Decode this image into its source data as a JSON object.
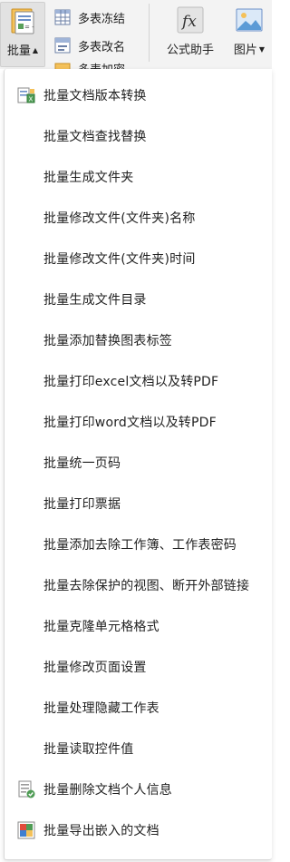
{
  "ribbon": {
    "batch_button": {
      "label": "批量",
      "icon": "batch-tools-icon"
    },
    "multi_sheet_freeze": {
      "label": "多表冻结",
      "icon": "table-grid-icon"
    },
    "multi_sheet_rename": {
      "label": "多表改名",
      "icon": "table-rename-icon"
    },
    "multi_sheet_third": {
      "label": "多表加密",
      "icon": "table-lock-icon"
    },
    "formula_helper": {
      "label": "公式助手",
      "icon": "fx-icon"
    },
    "picture": {
      "label": "图片",
      "icon": "picture-icon"
    }
  },
  "menu": {
    "items": [
      {
        "label": "批量文档版本转换",
        "icon": "convert-version-icon"
      },
      {
        "label": "批量文档查找替换"
      },
      {
        "label": "批量生成文件夹"
      },
      {
        "label": "批量修改文件(文件夹)名称"
      },
      {
        "label": "批量修改文件(文件夹)时间"
      },
      {
        "label": "批量生成文件目录"
      },
      {
        "label": "批量添加替换图表标签"
      },
      {
        "label": "批量打印excel文档以及转PDF"
      },
      {
        "label": "批量打印word文档以及转PDF"
      },
      {
        "label": "批量统一页码"
      },
      {
        "label": "批量打印票据"
      },
      {
        "label": "批量添加去除工作簿、工作表密码"
      },
      {
        "label": "批量去除保护的视图、断开外部链接"
      },
      {
        "label": "批量克隆单元格格式"
      },
      {
        "label": "批量修改页面设置"
      },
      {
        "label": "批量处理隐藏工作表"
      },
      {
        "label": "批量读取控件值"
      },
      {
        "label": "批量删除文档个人信息",
        "icon": "remove-personal-info-icon"
      },
      {
        "label": "批量导出嵌入的文档",
        "icon": "export-embedded-icon"
      }
    ]
  },
  "colors": {
    "ribbon_bg": "#f3f3f3",
    "pressed_bg": "#e2e2e2",
    "menu_bg": "#ffffff",
    "text": "#222222"
  }
}
